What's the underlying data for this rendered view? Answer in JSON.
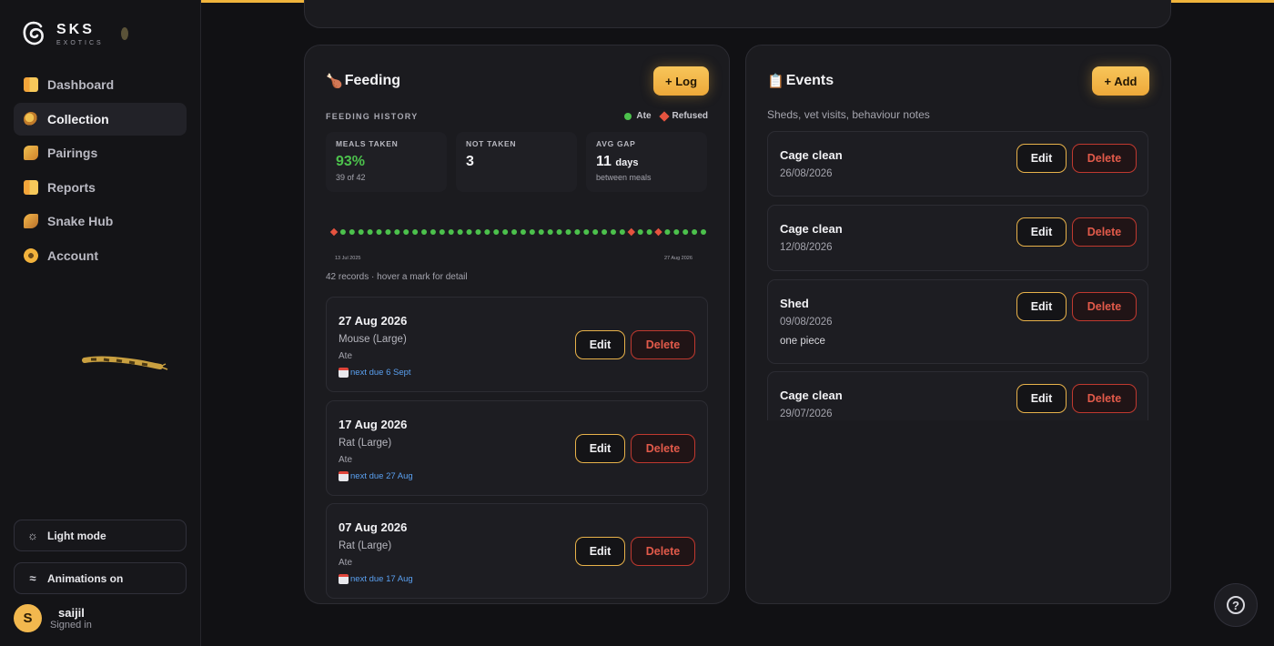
{
  "brand": {
    "name": "SKS",
    "sub": "EXOTICS"
  },
  "sidebar": {
    "items": [
      {
        "label": "Dashboard",
        "icon": "book-icon"
      },
      {
        "label": "Collection",
        "icon": "snake-icon",
        "active": true
      },
      {
        "label": "Pairings",
        "icon": "pairing-icon"
      },
      {
        "label": "Reports",
        "icon": "book-icon"
      },
      {
        "label": "Snake Hub",
        "icon": "hub-icon"
      },
      {
        "label": "Account",
        "icon": "gear-icon"
      }
    ],
    "light_mode_label": "Light mode",
    "animations_label": "Animations on"
  },
  "user": {
    "initial": "S",
    "name": "saijil",
    "status": "Signed in"
  },
  "feeding": {
    "title": "Feeding",
    "log_button": "+ Log",
    "history_label": "FEEDING HISTORY",
    "legend_ate": "Ate",
    "legend_refused": "Refused",
    "stats": [
      {
        "label": "MEALS TAKEN",
        "value": "93%",
        "sub": "39 of 42"
      },
      {
        "label": "NOT TAKEN",
        "value": "3",
        "sub": ""
      },
      {
        "label": "AVG GAP",
        "value": "11",
        "unit": "days",
        "sub": "between meals"
      }
    ],
    "timeline": {
      "start_label": "13 Jul 2025",
      "end_label": "27 Aug 2026",
      "marks": [
        "refused",
        "ate",
        "ate",
        "ate",
        "ate",
        "ate",
        "ate",
        "ate",
        "ate",
        "ate",
        "ate",
        "ate",
        "ate",
        "ate",
        "ate",
        "ate",
        "ate",
        "ate",
        "ate",
        "ate",
        "ate",
        "ate",
        "ate",
        "ate",
        "ate",
        "ate",
        "ate",
        "ate",
        "ate",
        "ate",
        "ate",
        "ate",
        "ate",
        "refused",
        "ate",
        "ate",
        "refused",
        "ate",
        "ate",
        "ate",
        "ate",
        "ate"
      ],
      "colors": {
        "ate": "#4cc14c",
        "refused": "#e5533f"
      }
    },
    "records_note": "42 records · hover a mark for detail",
    "records": [
      {
        "date": "27 Aug 2026",
        "food": "Mouse (Large)",
        "status": "Ate",
        "due": "next due 6 Sept"
      },
      {
        "date": "17 Aug 2026",
        "food": "Rat (Large)",
        "status": "Ate",
        "due": "next due 27 Aug"
      },
      {
        "date": "07 Aug 2026",
        "food": "Rat (Large)",
        "status": "Ate",
        "due": "next due 17 Aug"
      }
    ],
    "edit_label": "Edit",
    "delete_label": "Delete"
  },
  "events": {
    "title": "Events",
    "add_button": "+ Add",
    "subtitle": "Sheds, vet visits, behaviour notes",
    "items": [
      {
        "title": "Cage clean",
        "date": "26/08/2026",
        "note": ""
      },
      {
        "title": "Cage clean",
        "date": "12/08/2026",
        "note": ""
      },
      {
        "title": "Shed",
        "date": "09/08/2026",
        "note": "one piece"
      },
      {
        "title": "Cage clean",
        "date": "29/07/2026",
        "note": ""
      }
    ],
    "edit_label": "Edit",
    "delete_label": "Delete"
  },
  "colors": {
    "accent": "#f0b43c",
    "ate": "#4cc14c",
    "refused": "#e5533f",
    "danger": "#e25a4a",
    "link": "#5aa0f0"
  }
}
